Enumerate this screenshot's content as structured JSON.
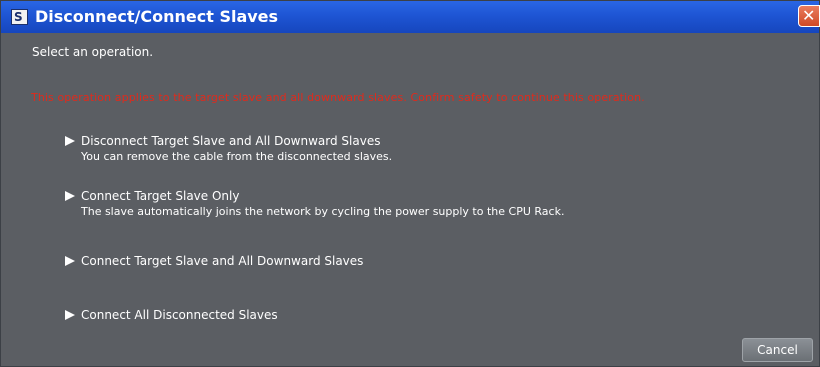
{
  "window": {
    "title": "Disconnect/Connect Slaves",
    "app_icon_glyph": "S",
    "close_glyph": "✕"
  },
  "dialog": {
    "prompt": "Select an operation.",
    "warning": "This operation applies to the target slave and all downward slaves. Confirm safety to continue this operation.",
    "warning_color": "#e02a1c",
    "options": [
      {
        "label": "Disconnect Target Slave and All Downward Slaves",
        "description": "You can remove the cable from the disconnected slaves."
      },
      {
        "label": "Connect Target Slave Only",
        "description": "The slave automatically joins the network by cycling the power supply to the CPU Rack."
      },
      {
        "label": "Connect Target Slave and All Downward Slaves",
        "description": ""
      },
      {
        "label": "Connect All Disconnected Slaves",
        "description": ""
      }
    ],
    "cancel_label": "Cancel"
  },
  "icons": [
    "app-icon",
    "close-icon",
    "arrow-right-icon"
  ],
  "colors": {
    "background": "#5b5e63",
    "titlebar": "#1e55d4",
    "text": "#ffffff"
  }
}
